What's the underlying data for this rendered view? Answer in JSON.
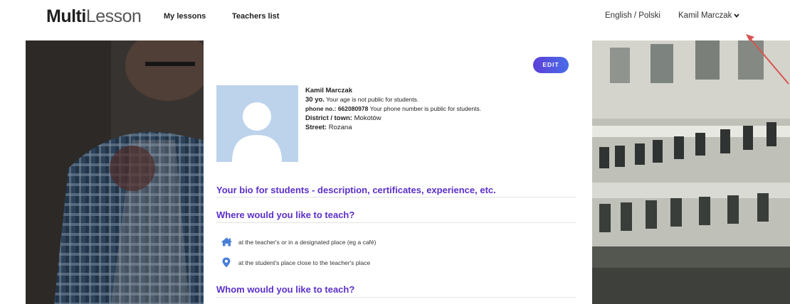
{
  "header": {
    "logo_bold": "Multi",
    "logo_light": "Lesson",
    "nav": [
      "My lessons",
      "Teachers list"
    ],
    "language": "English / Polski",
    "user_name": "Kamil Marczak"
  },
  "profile": {
    "edit_label": "EDIT",
    "name": "Kamil Marczak",
    "age_label": "30 yo.",
    "age_note": "Your age is not public for students.",
    "phone_label": "phone no.:",
    "phone_value": "662080978",
    "phone_note": "Your phone number is public for students.",
    "district_label": "District / town:",
    "district_value": "Mokotów",
    "street_label": "Street:",
    "street_value": "Rozana"
  },
  "sections": {
    "bio_title": "Your bio for students - description, certificates, experience, etc.",
    "where_title": "Where would you like to teach?",
    "where_options": [
      {
        "icon": "home-icon",
        "label": "at the teacher's or in a designated place (eg a café)"
      },
      {
        "icon": "location-pin-icon",
        "label": "at the student's place close to the teacher's place"
      }
    ],
    "whom_title": "Whom would you like to teach?"
  },
  "colors": {
    "accent_purple": "#5b2fc9",
    "edit_gradient_start": "#5b3fd8",
    "edit_gradient_end": "#4a6de8",
    "icon_blue": "#4a7fd8",
    "avatar_bg": "#bdd3ec",
    "annotation_arrow": "#d9534f"
  }
}
